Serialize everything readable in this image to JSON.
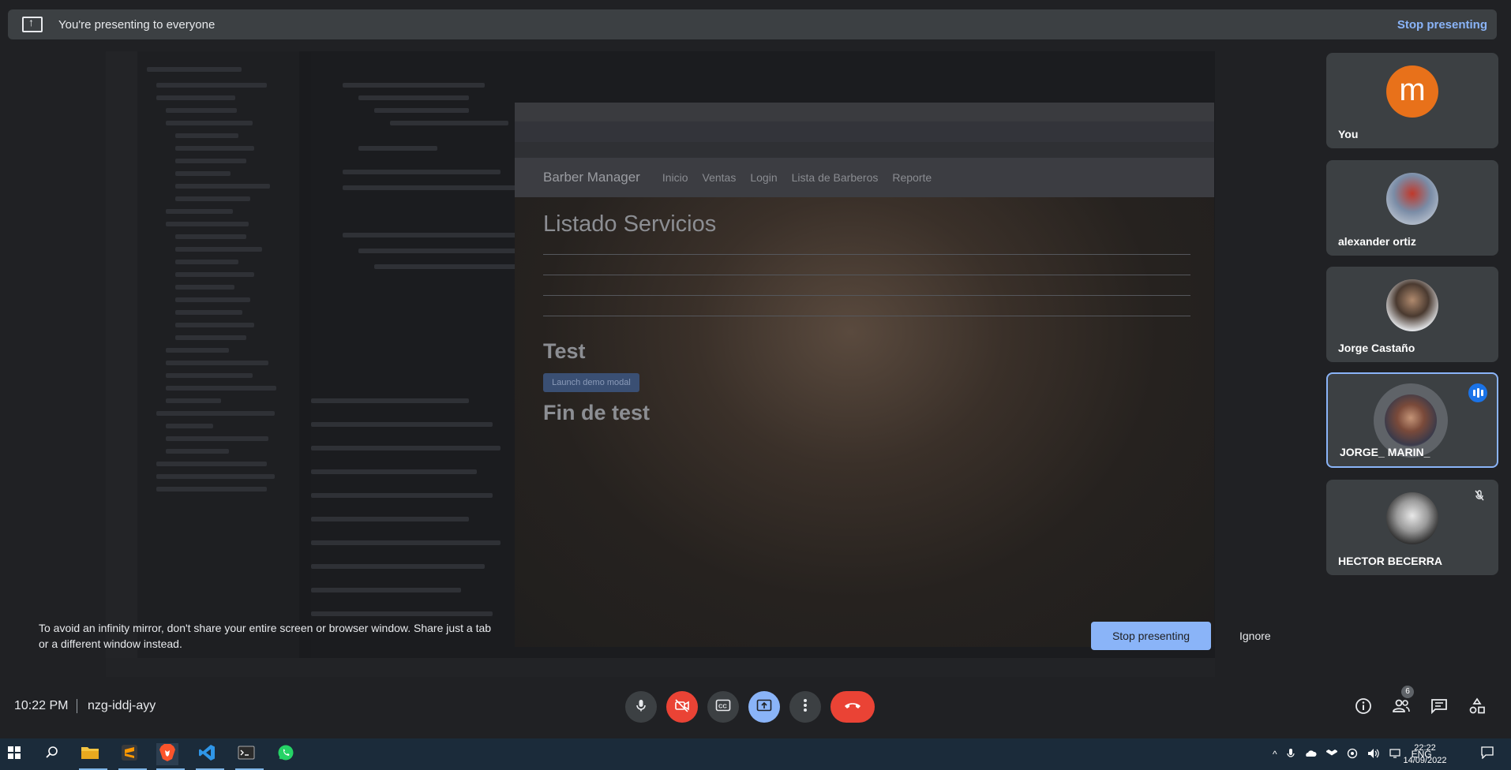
{
  "banner": {
    "text": "You're presenting to everyone",
    "stop_label": "Stop presenting"
  },
  "shared_page": {
    "nav": [
      "Barber Manager",
      "Inicio",
      "Ventas",
      "Login",
      "Lista de Barberos",
      "Reporte"
    ],
    "heading": "Listado Servicios",
    "test_heading": "Test",
    "demo_button": "Launch demo modal",
    "end_heading": "Fin de test"
  },
  "warning": {
    "text": "To avoid an infinity mirror, don't share your entire screen or browser window. Share just a tab or a different window instead.",
    "stop_label": "Stop presenting",
    "ignore_label": "Ignore"
  },
  "participants": [
    {
      "name": "You",
      "initial": "m",
      "color": "#e8711a",
      "muted": false,
      "speaking": false
    },
    {
      "name": "alexander ortiz",
      "muted": false,
      "speaking": false
    },
    {
      "name": "Jorge Castaño",
      "muted": false,
      "speaking": false
    },
    {
      "name": "JORGE_ MARIN_",
      "muted": false,
      "speaking": true
    },
    {
      "name": "HECTOR BECERRA",
      "muted": true,
      "speaking": false
    }
  ],
  "meeting": {
    "time": "10:22 PM",
    "code": "nzg-iddj-ayy",
    "participant_count": "6"
  },
  "controls": [
    "mic-icon",
    "camera-off-icon",
    "captions-icon",
    "present-icon",
    "more-icon",
    "end-call-icon"
  ],
  "right_controls": [
    "info-icon",
    "people-icon",
    "chat-icon",
    "activities-icon"
  ],
  "taskbar": {
    "apps": [
      "windows-start-icon",
      "search-icon",
      "file-explorer-icon",
      "sublime-icon",
      "brave-icon",
      "vscode-icon",
      "terminal-icon",
      "whatsapp-icon"
    ],
    "lang": "ENG",
    "clock_time": "22:22",
    "clock_date": "14/09/2022"
  }
}
